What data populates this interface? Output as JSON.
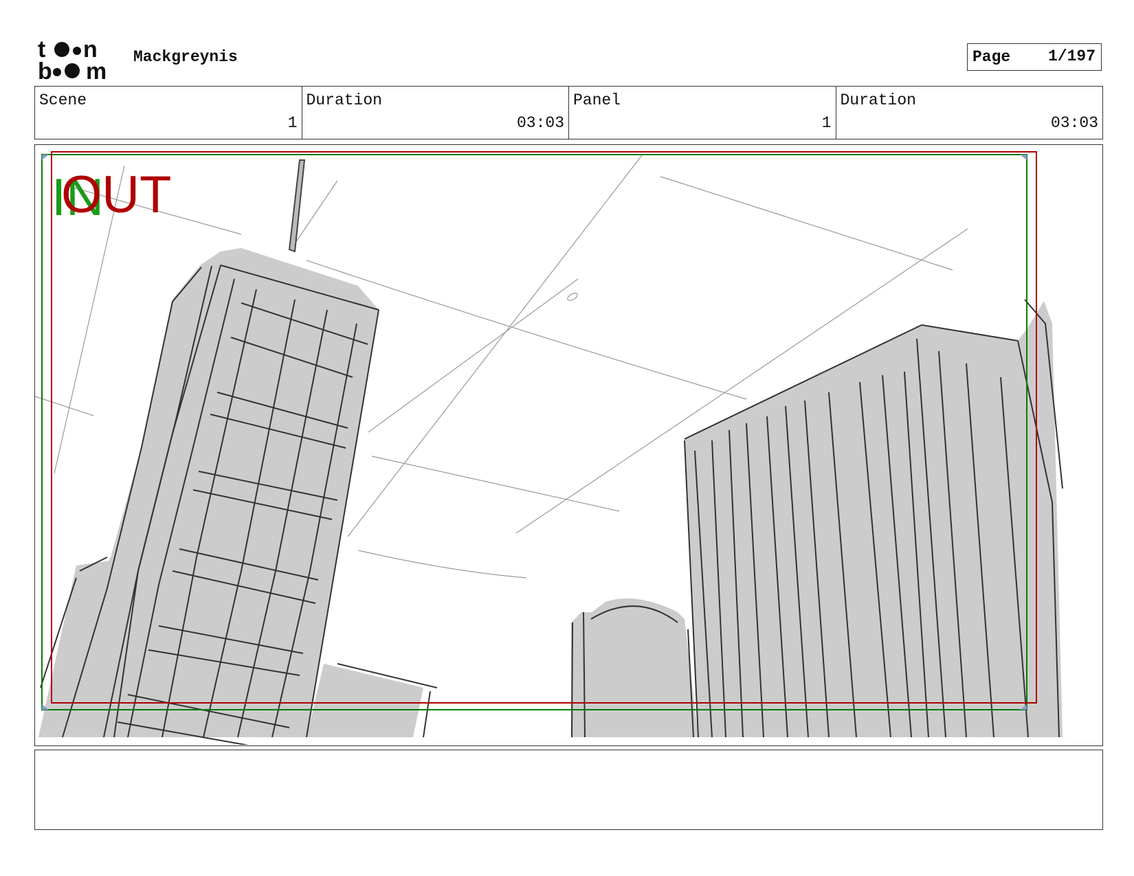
{
  "header": {
    "logo_alt": "toon boom",
    "project_title": "Mackgreynis",
    "page_label": "Page",
    "page_value": "1/197"
  },
  "info": {
    "scene_label": "Scene",
    "scene_value": "1",
    "scene_duration_label": "Duration",
    "scene_duration_value": "03:03",
    "panel_label": "Panel",
    "panel_value": "1",
    "panel_duration_label": "Duration",
    "panel_duration_value": "03:03"
  },
  "panel": {
    "in_marker": "IN",
    "out_marker": "OUT",
    "in_color": "#1a9a1a",
    "out_color": "#b00000",
    "building_fill": "#cccccc"
  },
  "notes": {
    "text": ""
  }
}
